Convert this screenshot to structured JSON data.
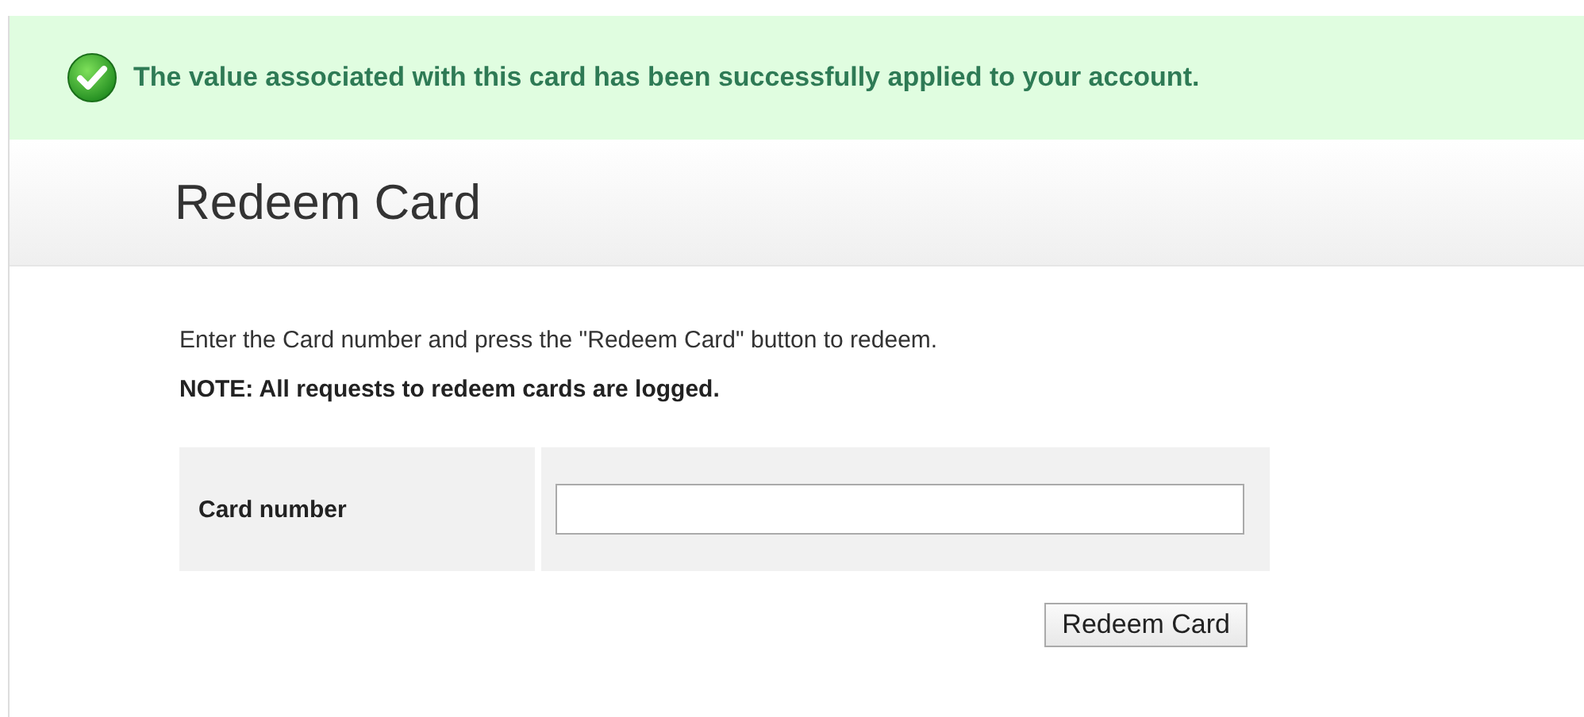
{
  "banner": {
    "message": "The value associated with this card has been successfully applied to your account."
  },
  "header": {
    "title": "Redeem Card"
  },
  "instructions": "Enter the Card number and press the \"Redeem Card\" button to redeem.",
  "note": "NOTE: All requests to redeem cards are logged.",
  "form": {
    "label": "Card number",
    "button": "Redeem Card"
  }
}
